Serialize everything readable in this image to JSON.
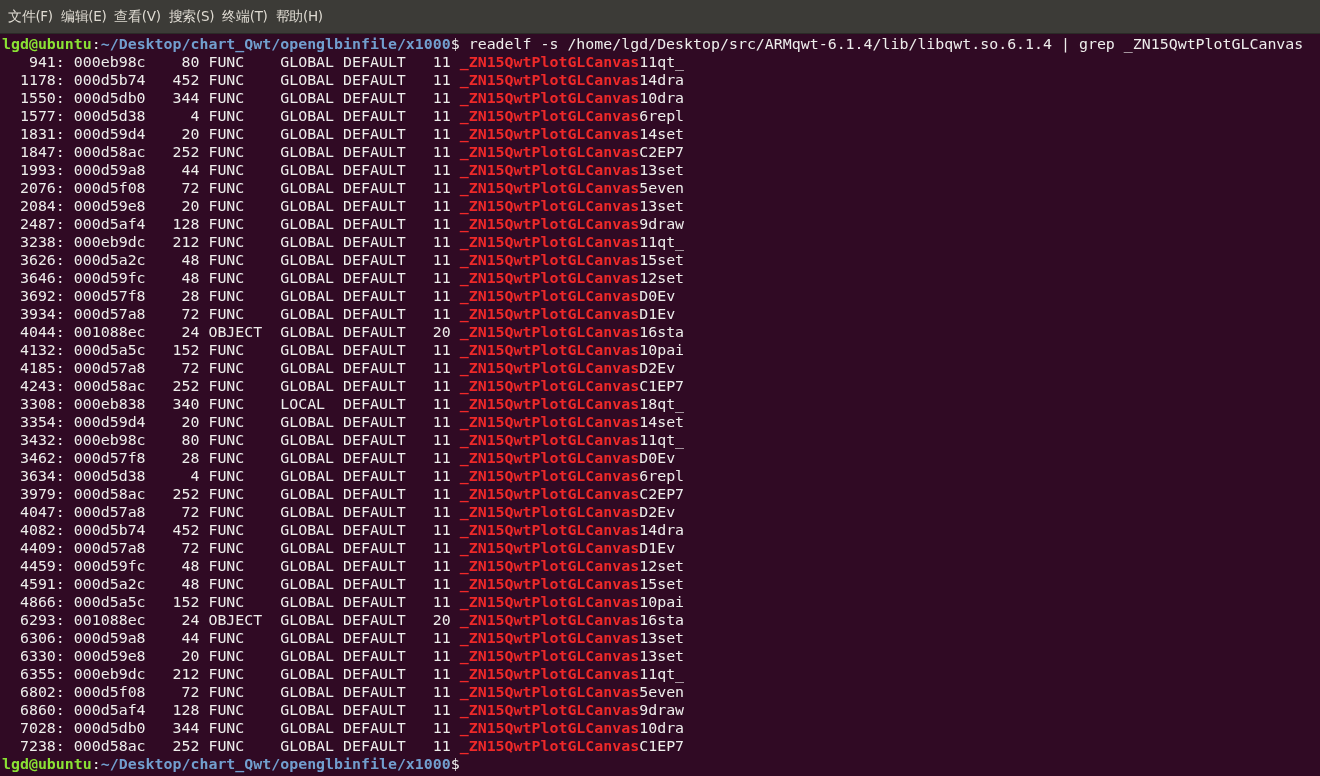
{
  "menu": [
    "文件(F)",
    "编辑(E)",
    "查看(V)",
    "搜索(S)",
    "终端(T)",
    "帮助(H)"
  ],
  "command_prompt": {
    "user": "lgd@ubuntu",
    "separator": ":",
    "path": "~/Desktop/chart_Qwt/openglbinfile/x1000",
    "symbol": "$",
    "command": "readelf -s /home/lgd/Desktop/src/ARMqwt-6.1.4/lib/libqwt.so.6.1.4 | grep _ZN15QwtPlotGLCanvas"
  },
  "rows": [
    {
      "num": "941:",
      "value": "000eb98c",
      "size": "80",
      "type": "FUNC",
      "bind": "GLOBAL",
      "vis": "DEFAULT",
      "ndx": "11",
      "match": "_ZN15QwtPlotGLCanvas",
      "rest": "11qt_"
    },
    {
      "num": "1178:",
      "value": "000d5b74",
      "size": "452",
      "type": "FUNC",
      "bind": "GLOBAL",
      "vis": "DEFAULT",
      "ndx": "11",
      "match": "_ZN15QwtPlotGLCanvas",
      "rest": "14dra"
    },
    {
      "num": "1550:",
      "value": "000d5db0",
      "size": "344",
      "type": "FUNC",
      "bind": "GLOBAL",
      "vis": "DEFAULT",
      "ndx": "11",
      "match": "_ZN15QwtPlotGLCanvas",
      "rest": "10dra"
    },
    {
      "num": "1577:",
      "value": "000d5d38",
      "size": "4",
      "type": "FUNC",
      "bind": "GLOBAL",
      "vis": "DEFAULT",
      "ndx": "11",
      "match": "_ZN15QwtPlotGLCanvas",
      "rest": "6repl"
    },
    {
      "num": "1831:",
      "value": "000d59d4",
      "size": "20",
      "type": "FUNC",
      "bind": "GLOBAL",
      "vis": "DEFAULT",
      "ndx": "11",
      "match": "_ZN15QwtPlotGLCanvas",
      "rest": "14set"
    },
    {
      "num": "1847:",
      "value": "000d58ac",
      "size": "252",
      "type": "FUNC",
      "bind": "GLOBAL",
      "vis": "DEFAULT",
      "ndx": "11",
      "match": "_ZN15QwtPlotGLCanvas",
      "rest": "C2EP7"
    },
    {
      "num": "1993:",
      "value": "000d59a8",
      "size": "44",
      "type": "FUNC",
      "bind": "GLOBAL",
      "vis": "DEFAULT",
      "ndx": "11",
      "match": "_ZN15QwtPlotGLCanvas",
      "rest": "13set"
    },
    {
      "num": "2076:",
      "value": "000d5f08",
      "size": "72",
      "type": "FUNC",
      "bind": "GLOBAL",
      "vis": "DEFAULT",
      "ndx": "11",
      "match": "_ZN15QwtPlotGLCanvas",
      "rest": "5even"
    },
    {
      "num": "2084:",
      "value": "000d59e8",
      "size": "20",
      "type": "FUNC",
      "bind": "GLOBAL",
      "vis": "DEFAULT",
      "ndx": "11",
      "match": "_ZN15QwtPlotGLCanvas",
      "rest": "13set"
    },
    {
      "num": "2487:",
      "value": "000d5af4",
      "size": "128",
      "type": "FUNC",
      "bind": "GLOBAL",
      "vis": "DEFAULT",
      "ndx": "11",
      "match": "_ZN15QwtPlotGLCanvas",
      "rest": "9draw"
    },
    {
      "num": "3238:",
      "value": "000eb9dc",
      "size": "212",
      "type": "FUNC",
      "bind": "GLOBAL",
      "vis": "DEFAULT",
      "ndx": "11",
      "match": "_ZN15QwtPlotGLCanvas",
      "rest": "11qt_"
    },
    {
      "num": "3626:",
      "value": "000d5a2c",
      "size": "48",
      "type": "FUNC",
      "bind": "GLOBAL",
      "vis": "DEFAULT",
      "ndx": "11",
      "match": "_ZN15QwtPlotGLCanvas",
      "rest": "15set"
    },
    {
      "num": "3646:",
      "value": "000d59fc",
      "size": "48",
      "type": "FUNC",
      "bind": "GLOBAL",
      "vis": "DEFAULT",
      "ndx": "11",
      "match": "_ZN15QwtPlotGLCanvas",
      "rest": "12set"
    },
    {
      "num": "3692:",
      "value": "000d57f8",
      "size": "28",
      "type": "FUNC",
      "bind": "GLOBAL",
      "vis": "DEFAULT",
      "ndx": "11",
      "match": "_ZN15QwtPlotGLCanvas",
      "rest": "D0Ev"
    },
    {
      "num": "3934:",
      "value": "000d57a8",
      "size": "72",
      "type": "FUNC",
      "bind": "GLOBAL",
      "vis": "DEFAULT",
      "ndx": "11",
      "match": "_ZN15QwtPlotGLCanvas",
      "rest": "D1Ev"
    },
    {
      "num": "4044:",
      "value": "001088ec",
      "size": "24",
      "type": "OBJECT",
      "bind": "GLOBAL",
      "vis": "DEFAULT",
      "ndx": "20",
      "match": "_ZN15QwtPlotGLCanvas",
      "rest": "16sta"
    },
    {
      "num": "4132:",
      "value": "000d5a5c",
      "size": "152",
      "type": "FUNC",
      "bind": "GLOBAL",
      "vis": "DEFAULT",
      "ndx": "11",
      "match": "_ZN15QwtPlotGLCanvas",
      "rest": "10pai"
    },
    {
      "num": "4185:",
      "value": "000d57a8",
      "size": "72",
      "type": "FUNC",
      "bind": "GLOBAL",
      "vis": "DEFAULT",
      "ndx": "11",
      "match": "_ZN15QwtPlotGLCanvas",
      "rest": "D2Ev"
    },
    {
      "num": "4243:",
      "value": "000d58ac",
      "size": "252",
      "type": "FUNC",
      "bind": "GLOBAL",
      "vis": "DEFAULT",
      "ndx": "11",
      "match": "_ZN15QwtPlotGLCanvas",
      "rest": "C1EP7"
    },
    {
      "num": "3308:",
      "value": "000eb838",
      "size": "340",
      "type": "FUNC",
      "bind": "LOCAL",
      "vis": "DEFAULT",
      "ndx": "11",
      "match": "_ZN15QwtPlotGLCanvas",
      "rest": "18qt_"
    },
    {
      "num": "3354:",
      "value": "000d59d4",
      "size": "20",
      "type": "FUNC",
      "bind": "GLOBAL",
      "vis": "DEFAULT",
      "ndx": "11",
      "match": "_ZN15QwtPlotGLCanvas",
      "rest": "14set"
    },
    {
      "num": "3432:",
      "value": "000eb98c",
      "size": "80",
      "type": "FUNC",
      "bind": "GLOBAL",
      "vis": "DEFAULT",
      "ndx": "11",
      "match": "_ZN15QwtPlotGLCanvas",
      "rest": "11qt_"
    },
    {
      "num": "3462:",
      "value": "000d57f8",
      "size": "28",
      "type": "FUNC",
      "bind": "GLOBAL",
      "vis": "DEFAULT",
      "ndx": "11",
      "match": "_ZN15QwtPlotGLCanvas",
      "rest": "D0Ev"
    },
    {
      "num": "3634:",
      "value": "000d5d38",
      "size": "4",
      "type": "FUNC",
      "bind": "GLOBAL",
      "vis": "DEFAULT",
      "ndx": "11",
      "match": "_ZN15QwtPlotGLCanvas",
      "rest": "6repl"
    },
    {
      "num": "3979:",
      "value": "000d58ac",
      "size": "252",
      "type": "FUNC",
      "bind": "GLOBAL",
      "vis": "DEFAULT",
      "ndx": "11",
      "match": "_ZN15QwtPlotGLCanvas",
      "rest": "C2EP7"
    },
    {
      "num": "4047:",
      "value": "000d57a8",
      "size": "72",
      "type": "FUNC",
      "bind": "GLOBAL",
      "vis": "DEFAULT",
      "ndx": "11",
      "match": "_ZN15QwtPlotGLCanvas",
      "rest": "D2Ev"
    },
    {
      "num": "4082:",
      "value": "000d5b74",
      "size": "452",
      "type": "FUNC",
      "bind": "GLOBAL",
      "vis": "DEFAULT",
      "ndx": "11",
      "match": "_ZN15QwtPlotGLCanvas",
      "rest": "14dra"
    },
    {
      "num": "4409:",
      "value": "000d57a8",
      "size": "72",
      "type": "FUNC",
      "bind": "GLOBAL",
      "vis": "DEFAULT",
      "ndx": "11",
      "match": "_ZN15QwtPlotGLCanvas",
      "rest": "D1Ev"
    },
    {
      "num": "4459:",
      "value": "000d59fc",
      "size": "48",
      "type": "FUNC",
      "bind": "GLOBAL",
      "vis": "DEFAULT",
      "ndx": "11",
      "match": "_ZN15QwtPlotGLCanvas",
      "rest": "12set"
    },
    {
      "num": "4591:",
      "value": "000d5a2c",
      "size": "48",
      "type": "FUNC",
      "bind": "GLOBAL",
      "vis": "DEFAULT",
      "ndx": "11",
      "match": "_ZN15QwtPlotGLCanvas",
      "rest": "15set"
    },
    {
      "num": "4866:",
      "value": "000d5a5c",
      "size": "152",
      "type": "FUNC",
      "bind": "GLOBAL",
      "vis": "DEFAULT",
      "ndx": "11",
      "match": "_ZN15QwtPlotGLCanvas",
      "rest": "10pai"
    },
    {
      "num": "6293:",
      "value": "001088ec",
      "size": "24",
      "type": "OBJECT",
      "bind": "GLOBAL",
      "vis": "DEFAULT",
      "ndx": "20",
      "match": "_ZN15QwtPlotGLCanvas",
      "rest": "16sta"
    },
    {
      "num": "6306:",
      "value": "000d59a8",
      "size": "44",
      "type": "FUNC",
      "bind": "GLOBAL",
      "vis": "DEFAULT",
      "ndx": "11",
      "match": "_ZN15QwtPlotGLCanvas",
      "rest": "13set"
    },
    {
      "num": "6330:",
      "value": "000d59e8",
      "size": "20",
      "type": "FUNC",
      "bind": "GLOBAL",
      "vis": "DEFAULT",
      "ndx": "11",
      "match": "_ZN15QwtPlotGLCanvas",
      "rest": "13set"
    },
    {
      "num": "6355:",
      "value": "000eb9dc",
      "size": "212",
      "type": "FUNC",
      "bind": "GLOBAL",
      "vis": "DEFAULT",
      "ndx": "11",
      "match": "_ZN15QwtPlotGLCanvas",
      "rest": "11qt_"
    },
    {
      "num": "6802:",
      "value": "000d5f08",
      "size": "72",
      "type": "FUNC",
      "bind": "GLOBAL",
      "vis": "DEFAULT",
      "ndx": "11",
      "match": "_ZN15QwtPlotGLCanvas",
      "rest": "5even"
    },
    {
      "num": "6860:",
      "value": "000d5af4",
      "size": "128",
      "type": "FUNC",
      "bind": "GLOBAL",
      "vis": "DEFAULT",
      "ndx": "11",
      "match": "_ZN15QwtPlotGLCanvas",
      "rest": "9draw"
    },
    {
      "num": "7028:",
      "value": "000d5db0",
      "size": "344",
      "type": "FUNC",
      "bind": "GLOBAL",
      "vis": "DEFAULT",
      "ndx": "11",
      "match": "_ZN15QwtPlotGLCanvas",
      "rest": "10dra"
    },
    {
      "num": "7238:",
      "value": "000d58ac",
      "size": "252",
      "type": "FUNC",
      "bind": "GLOBAL",
      "vis": "DEFAULT",
      "ndx": "11",
      "match": "_ZN15QwtPlotGLCanvas",
      "rest": "C1EP7"
    }
  ],
  "final_prompt": {
    "user": "lgd@ubuntu",
    "separator": ":",
    "path": "~/Desktop/chart_Qwt/openglbinfile/x1000",
    "symbol": "$"
  }
}
